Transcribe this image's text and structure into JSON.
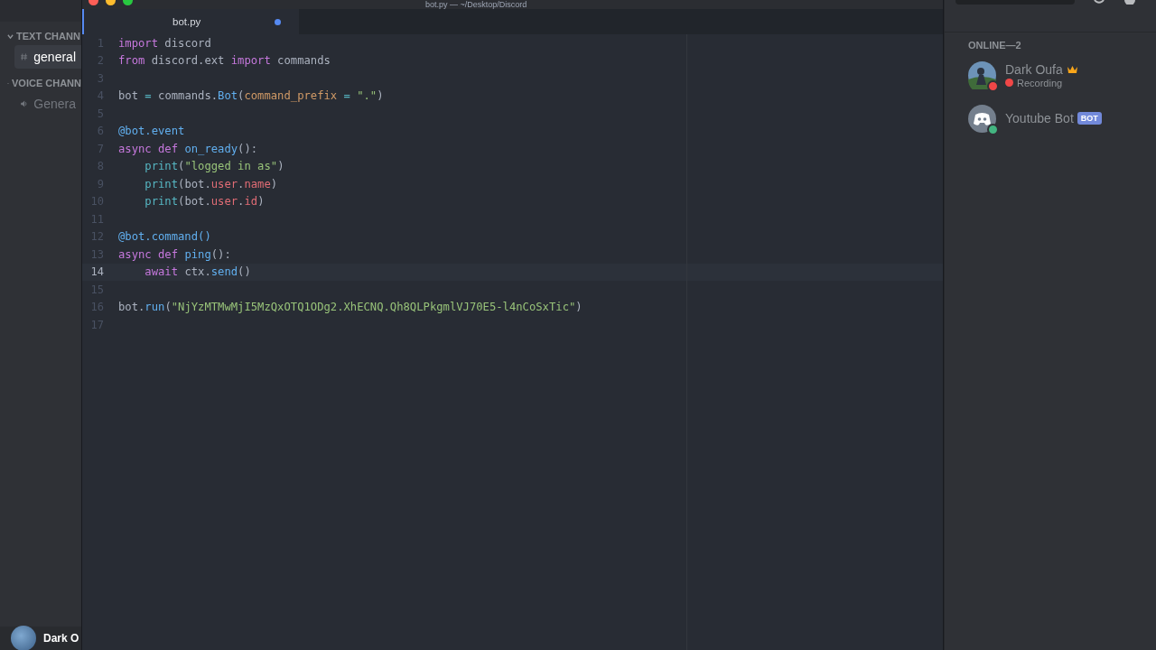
{
  "window": {
    "title": "bot.py — ~/Desktop/Discord"
  },
  "sidebar": {
    "sections": [
      {
        "title": "TEXT CHANN",
        "channels": [
          {
            "kind": "text",
            "name": "general",
            "selected": true
          }
        ]
      },
      {
        "title": "VOICE CHANN",
        "channels": [
          {
            "kind": "voice",
            "name": "Genera",
            "selected": false
          }
        ]
      }
    ],
    "user": {
      "name": "Dark O"
    }
  },
  "editor": {
    "tabs": [
      {
        "label": "bot.py",
        "selected": true,
        "modified": true
      }
    ],
    "lines": [
      {
        "number": "1",
        "current": false,
        "tokens": [
          {
            "kind": "kw",
            "text": "import"
          },
          {
            "kind": "plain",
            "text": " discord"
          }
        ]
      },
      {
        "number": "2",
        "current": false,
        "tokens": [
          {
            "kind": "kw",
            "text": "from"
          },
          {
            "kind": "plain",
            "text": " discord.ext "
          },
          {
            "kind": "kw",
            "text": "import"
          },
          {
            "kind": "plain",
            "text": " commands"
          }
        ]
      },
      {
        "number": "3",
        "current": false
      },
      {
        "number": "4",
        "current": false,
        "tokens": [
          {
            "kind": "plain",
            "text": "bot "
          },
          {
            "kind": "op",
            "text": "="
          },
          {
            "kind": "plain",
            "text": " commands."
          },
          {
            "kind": "fn",
            "text": "Bot"
          },
          {
            "kind": "plain",
            "text": "("
          },
          {
            "kind": "param",
            "text": "command_prefix"
          },
          {
            "kind": "op",
            "text": " = "
          },
          {
            "kind": "str",
            "text": "\".\""
          },
          {
            "kind": "plain",
            "text": ")"
          }
        ]
      },
      {
        "number": "5",
        "current": false
      },
      {
        "number": "6",
        "current": false,
        "tokens": [
          {
            "kind": "fn",
            "text": "@bot.event"
          }
        ]
      },
      {
        "number": "7",
        "current": false,
        "tokens": [
          {
            "kind": "kw",
            "text": "async def"
          },
          {
            "kind": "fn",
            "text": " on_ready"
          },
          {
            "kind": "plain",
            "text": "():"
          }
        ]
      },
      {
        "number": "8",
        "current": false,
        "tokens": [
          {
            "kind": "builtin",
            "text": "    print"
          },
          {
            "kind": "plain",
            "text": "("
          },
          {
            "kind": "str",
            "text": "\"logged in as\""
          },
          {
            "kind": "plain",
            "text": ")"
          }
        ]
      },
      {
        "number": "9",
        "current": false,
        "tokens": [
          {
            "kind": "builtin",
            "text": "    print"
          },
          {
            "kind": "plain",
            "text": "(bot."
          },
          {
            "kind": "prop",
            "text": "user"
          },
          {
            "kind": "plain",
            "text": "."
          },
          {
            "kind": "prop",
            "text": "name"
          },
          {
            "kind": "plain",
            "text": ")"
          }
        ]
      },
      {
        "number": "10",
        "current": false,
        "tokens": [
          {
            "kind": "builtin",
            "text": "    print"
          },
          {
            "kind": "plain",
            "text": "(bot."
          },
          {
            "kind": "prop",
            "text": "user"
          },
          {
            "kind": "plain",
            "text": "."
          },
          {
            "kind": "prop",
            "text": "id"
          },
          {
            "kind": "plain",
            "text": ")"
          }
        ]
      },
      {
        "number": "11",
        "current": false
      },
      {
        "number": "12",
        "current": false,
        "tokens": [
          {
            "kind": "fn",
            "text": "@bot.command()"
          }
        ]
      },
      {
        "number": "13",
        "current": false,
        "tokens": [
          {
            "kind": "kw",
            "text": "async def"
          },
          {
            "kind": "fn",
            "text": " ping"
          },
          {
            "kind": "plain",
            "text": "():"
          }
        ]
      },
      {
        "number": "14",
        "current": true,
        "tokens": [
          {
            "kind": "kw",
            "text": "    await"
          },
          {
            "kind": "plain",
            "text": " ctx."
          },
          {
            "kind": "fn",
            "text": "send"
          },
          {
            "kind": "plain",
            "text": "()"
          }
        ]
      },
      {
        "number": "15",
        "current": false
      },
      {
        "number": "16",
        "current": false,
        "tokens": [
          {
            "kind": "plain",
            "text": "bot."
          },
          {
            "kind": "fn",
            "text": "run"
          },
          {
            "kind": "plain",
            "text": "("
          },
          {
            "kind": "str",
            "text": "\"NjYzMTMwMjI5MzQxOTQ1ODg2.XhECNQ.Qh8QLPkgmlVJ70E5-l4nCoSxTic\""
          },
          {
            "kind": "plain",
            "text": ")"
          }
        ]
      },
      {
        "number": "17",
        "current": false
      }
    ]
  },
  "members": {
    "heading": "ONLINE—2",
    "items": [
      {
        "kind": "user",
        "name": "Dark Oufa",
        "owner": true,
        "color": "#f04747",
        "activity": {
          "kind": "recording",
          "text": "Recording"
        }
      },
      {
        "kind": "bot",
        "name": "Youtube Bot",
        "owner": false,
        "color": "#43b581",
        "tag": "BOT"
      }
    ]
  }
}
